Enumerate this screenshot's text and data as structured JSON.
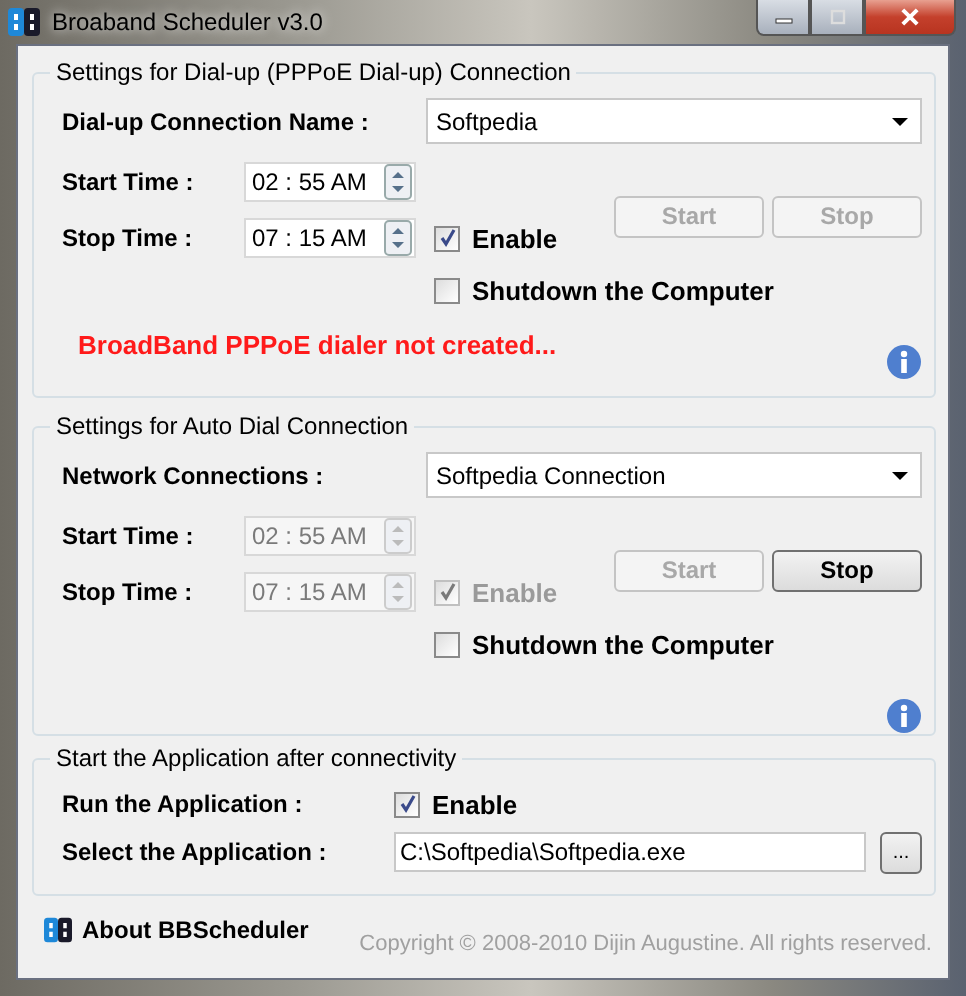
{
  "window": {
    "title": "Broaband Scheduler v3.0"
  },
  "connections": [
    {
      "title": "Settings for Dial-up (PPPoE Dial-up) Connection",
      "name_label": "Dial-up Connection Name :",
      "name_value": "Softpedia",
      "times": [
        {
          "label": "Start Time :",
          "value": "02 : 55  AM",
          "disabled": false
        },
        {
          "label": "Stop Time :",
          "value": "07 : 15  AM",
          "disabled": false
        }
      ],
      "enable": {
        "label": "Enable",
        "checked": true,
        "disabled": false
      },
      "shutdown": {
        "label": "Shutdown the Computer",
        "checked": false,
        "disabled": false
      },
      "buttons": [
        {
          "label": "Start",
          "disabled": true
        },
        {
          "label": "Stop",
          "disabled": true
        }
      ],
      "message": "BroadBand PPPoE dialer not created..."
    },
    {
      "title": "Settings for Auto Dial Connection",
      "name_label": "Network Connections :",
      "name_value": "Softpedia Connection",
      "times": [
        {
          "label": "Start Time :",
          "value": "02 : 55  AM",
          "disabled": true
        },
        {
          "label": "Stop Time :",
          "value": "07 : 15  AM",
          "disabled": true
        }
      ],
      "enable": {
        "label": "Enable",
        "checked": true,
        "disabled": true
      },
      "shutdown": {
        "label": "Shutdown the Computer",
        "checked": false,
        "disabled": false
      },
      "buttons": [
        {
          "label": "Start",
          "disabled": true
        },
        {
          "label": "Stop",
          "disabled": false
        }
      ]
    }
  ],
  "application": {
    "title": "Start the Application after connectivity",
    "run_label": "Run the Application :",
    "enable": {
      "label": "Enable",
      "checked": true
    },
    "select_label": "Select the Application :",
    "path": "C:\\Softpedia\\Softpedia.exe",
    "browse": "..."
  },
  "footer": {
    "about": "About BBScheduler",
    "copyright": "Copyright © 2008-2010  Dijin Augustine. All rights reserved."
  }
}
